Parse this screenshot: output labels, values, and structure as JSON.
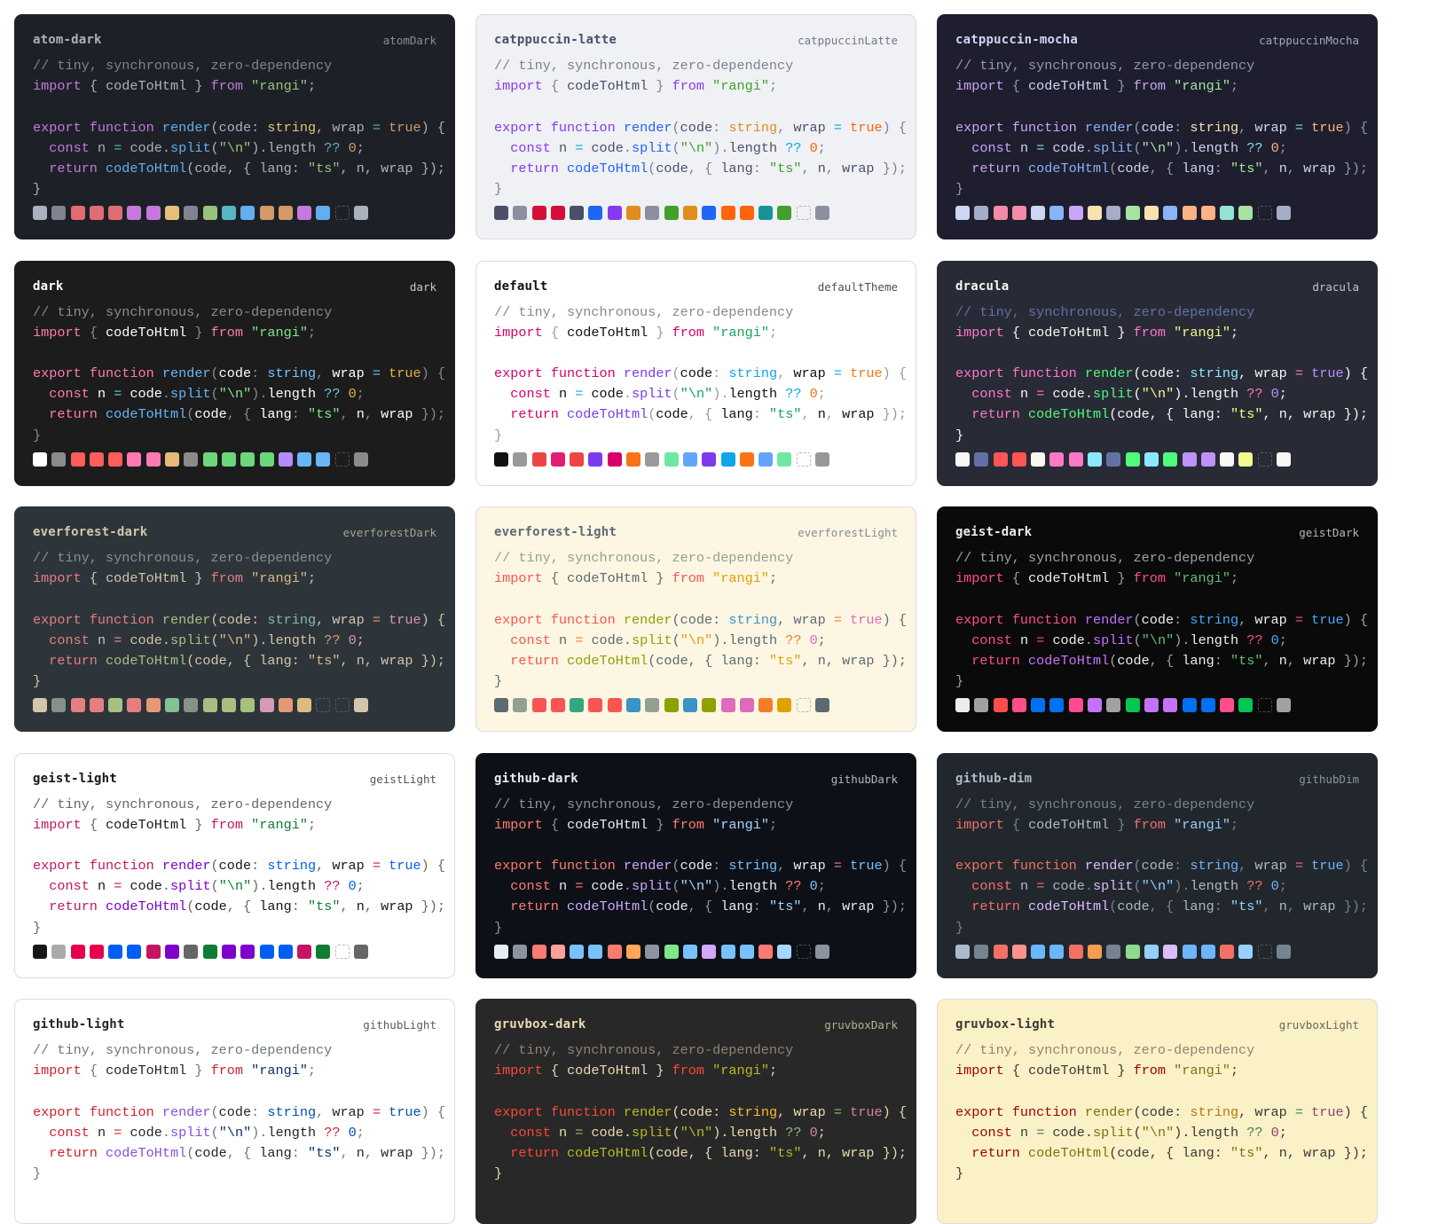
{
  "code_lines": {
    "comment": "// tiny, synchronous, zero-dependency",
    "import_kw": "import",
    "lbrace": "{",
    "rbrace": "}",
    "import_name": "codeToHtml",
    "from_kw": "from",
    "module": "\"rangi\"",
    "semi": ";",
    "export_kw": "export",
    "function_kw": "function",
    "fn_name": "render",
    "lparen": "(",
    "rparen": ")",
    "param_code": "code",
    "colon": ":",
    "type_string": "string",
    "comma": ",",
    "param_wrap": "wrap",
    "eq": "=",
    "bool_true": "true",
    "const_kw": "const",
    "var_n": "n",
    "dot": ".",
    "split_fn": "split",
    "newline_str": "\"\\n\"",
    "length_prop": "length",
    "nullish": "??",
    "zero": "0",
    "return_kw": "return",
    "call_fn": "codeToHtml",
    "prop_lang": "lang",
    "lang_ts": "\"ts\"",
    "close_call": "});",
    "close_block": "}"
  },
  "themes": [
    {
      "name": "atom-dark",
      "export": "atomDark",
      "bg": "#1d2127",
      "fg": "#abb2bf",
      "comment": "#7f848e",
      "keyword": "#c678dd",
      "fn": "#61afef",
      "string": "#98c379",
      "type": "#e5c07b",
      "number": "#d19a66",
      "punct": "#abb2bf",
      "op": "#56b6c2",
      "light": false,
      "swatches": [
        "#abb2bf",
        "#7f848e",
        "#e06c75",
        "#e06c75",
        "#e06c75",
        "#c678dd",
        "#c678dd",
        "#e5c07b",
        "#7f848e",
        "#98c379",
        "#56b6c2",
        "#61afef",
        "#d19a66",
        "#d19a66",
        "#c678dd",
        "#61afef",
        "",
        "#abb2bf"
      ]
    },
    {
      "name": "catppuccin-latte",
      "export": "catppuccinLatte",
      "bg": "#eff1f5",
      "fg": "#4c4f69",
      "comment": "#7c7f93",
      "keyword": "#8839ef",
      "fn": "#1e66f5",
      "string": "#40a02b",
      "type": "#df8e1d",
      "number": "#fe640b",
      "punct": "#7c7f93",
      "op": "#04a5e5",
      "light": true,
      "swatches": [
        "#4c4f69",
        "#8c8fa1",
        "#d20f39",
        "#d20f39",
        "#4c4f69",
        "#1e66f5",
        "#8839ef",
        "#df8e1d",
        "#8c8fa1",
        "#40a02b",
        "#df8e1d",
        "#1e66f5",
        "#fe640b",
        "#fe640b",
        "#179299",
        "#40a02b",
        "",
        "#8c8fa1"
      ]
    },
    {
      "name": "catppuccin-mocha",
      "export": "catppuccinMocha",
      "bg": "#1e1e2e",
      "fg": "#cdd6f4",
      "comment": "#9399b2",
      "keyword": "#cba6f7",
      "fn": "#89b4fa",
      "string": "#a6e3a1",
      "type": "#f9e2af",
      "number": "#fab387",
      "punct": "#9399b2",
      "op": "#89dceb",
      "light": false,
      "swatches": [
        "#cdd6f4",
        "#a6adc8",
        "#f38ba8",
        "#f38ba8",
        "#cdd6f4",
        "#89b4fa",
        "#cba6f7",
        "#f9e2af",
        "#a6adc8",
        "#a6e3a1",
        "#f9e2af",
        "#89b4fa",
        "#fab387",
        "#fab387",
        "#94e2d5",
        "#a6e3a1",
        "",
        "#a6adc8"
      ]
    },
    {
      "name": "dark",
      "export": "dark",
      "bg": "#1c1c1c",
      "fg": "#ffffff",
      "comment": "#8b8b8b",
      "keyword": "#ff7ab2",
      "fn": "#67b7f7",
      "string": "#7ee787",
      "type": "#79c0ff",
      "number": "#e3b341",
      "punct": "#8b8b8b",
      "op": "#5fd0e3",
      "light": false,
      "swatches": [
        "#ffffff",
        "#8b8b8b",
        "#ff5c5c",
        "#ff5c5c",
        "#ff5c5c",
        "#ff7ab2",
        "#ff7ab2",
        "#e6b97a",
        "#8b8b8b",
        "#6bd77a",
        "#6bd77a",
        "#6bd77a",
        "#6bd77a",
        "#b58cff",
        "#67b7f7",
        "#67b7f7",
        "",
        "#8b8b8b"
      ]
    },
    {
      "name": "default",
      "export": "defaultTheme",
      "bg": "#ffffff",
      "fg": "#111111",
      "comment": "#888888",
      "keyword": "#d7006b",
      "fn": "#7c3aed",
      "string": "#17a05d",
      "type": "#0ea5e9",
      "number": "#f97316",
      "punct": "#999999",
      "op": "#0ea5e9",
      "light": true,
      "swatches": [
        "#111111",
        "#999999",
        "#ef4444",
        "#e11d74",
        "#ef4444",
        "#7c3aed",
        "#d7006b",
        "#f97316",
        "#999999",
        "#6ee7a0",
        "#60a5fa",
        "#7c3aed",
        "#0ea5e9",
        "#f97316",
        "#60a5fa",
        "#6ee7a0",
        "",
        "#999999"
      ]
    },
    {
      "name": "dracula",
      "export": "dracula",
      "bg": "#282a36",
      "fg": "#f8f8f2",
      "comment": "#6272a4",
      "keyword": "#ff79c6",
      "fn": "#50fa7b",
      "string": "#f1fa8c",
      "type": "#8be9fd",
      "number": "#bd93f9",
      "punct": "#f8f8f2",
      "op": "#ff79c6",
      "light": false,
      "swatches": [
        "#f8f8f2",
        "#6272a4",
        "#ff5555",
        "#ff5555",
        "#f8f8f2",
        "#ff79c6",
        "#ff79c6",
        "#8be9fd",
        "#6272a4",
        "#50fa7b",
        "#8be9fd",
        "#50fa7b",
        "#bd93f9",
        "#bd93f9",
        "#f8f8f2",
        "#f1fa8c",
        "",
        "#f8f8f2"
      ]
    },
    {
      "name": "everforest-dark",
      "export": "everforestDark",
      "bg": "#2d353b",
      "fg": "#d3c6aa",
      "comment": "#859289",
      "keyword": "#e67e80",
      "fn": "#a7c080",
      "string": "#dbbc7f",
      "type": "#7fbbb3",
      "number": "#d699b6",
      "punct": "#d3c6aa",
      "op": "#e69875",
      "light": false,
      "swatches": [
        "#d3c6aa",
        "#859289",
        "#e67e80",
        "#e67e80",
        "#a7c080",
        "#e67e80",
        "#e69875",
        "#83c092",
        "#859289",
        "#a7c080",
        "#a7c080",
        "#a7c080",
        "#d699b6",
        "#e69875",
        "#dbbc7f",
        "",
        "",
        "#d3c6aa"
      ]
    },
    {
      "name": "everforest-light",
      "export": "everforestLight",
      "bg": "#fdf6e3",
      "fg": "#5c6a72",
      "comment": "#939f91",
      "keyword": "#f85552",
      "fn": "#8da101",
      "string": "#dfa000",
      "type": "#3a94c5",
      "number": "#df69ba",
      "punct": "#5c6a72",
      "op": "#f57d26",
      "light": true,
      "swatches": [
        "#5c6a72",
        "#939f91",
        "#f85552",
        "#f85552",
        "#35a77c",
        "#f85552",
        "#f85552",
        "#3a94c5",
        "#939f91",
        "#8da101",
        "#3a94c5",
        "#8da101",
        "#df69ba",
        "#df69ba",
        "#f57d26",
        "#dfa000",
        "",
        "#5c6a72"
      ]
    },
    {
      "name": "geist-dark",
      "export": "geistDark",
      "bg": "#0a0a0a",
      "fg": "#ededed",
      "comment": "#a1a1a1",
      "keyword": "#ff4d8d",
      "fn": "#c472fb",
      "string": "#62c073",
      "type": "#47a8ff",
      "number": "#47a8ff",
      "punct": "#a1a1a1",
      "op": "#ff4d8d",
      "light": false,
      "swatches": [
        "#ededed",
        "#a1a1a1",
        "#ff4d4d",
        "#ff4d8d",
        "#0070f3",
        "#0070f3",
        "#ff4d8d",
        "#c472fb",
        "#a1a1a1",
        "#00c853",
        "#c472fb",
        "#c472fb",
        "#0070f3",
        "#0070f3",
        "#ff4d8d",
        "#00c853",
        "",
        "#a1a1a1"
      ]
    },
    {
      "name": "geist-light",
      "export": "geistLight",
      "bg": "#ffffff",
      "fg": "#171717",
      "comment": "#666666",
      "keyword": "#c41562",
      "fn": "#7d00cc",
      "string": "#107d32",
      "type": "#005ff2",
      "number": "#005ff2",
      "punct": "#666666",
      "op": "#c41562",
      "light": true,
      "swatches": [
        "#171717",
        "#aaaaaa",
        "#e5004f",
        "#e5004f",
        "#005ff2",
        "#005ff2",
        "#c41562",
        "#7d00cc",
        "#666666",
        "#107d32",
        "#7d00cc",
        "#7d00cc",
        "#005ff2",
        "#005ff2",
        "#c41562",
        "#107d32",
        "",
        "#666666"
      ]
    },
    {
      "name": "github-dark",
      "export": "githubDark",
      "bg": "#0d1117",
      "fg": "#e6edf3",
      "comment": "#8b949e",
      "keyword": "#ff7b72",
      "fn": "#d2a8ff",
      "string": "#a5d6ff",
      "type": "#79c0ff",
      "number": "#79c0ff",
      "punct": "#8b949e",
      "op": "#ff7b72",
      "light": false,
      "swatches": [
        "#e6edf3",
        "#8b949e",
        "#ff7b72",
        "#ffa198",
        "#79c0ff",
        "#79c0ff",
        "#ff7b72",
        "#ffa657",
        "#8b949e",
        "#7ee787",
        "#79c0ff",
        "#d2a8ff",
        "#79c0ff",
        "#79c0ff",
        "#ff7b72",
        "#a5d6ff",
        "",
        "#8b949e"
      ]
    },
    {
      "name": "github-dim",
      "export": "githubDim",
      "bg": "#22272e",
      "fg": "#adbac7",
      "comment": "#768390",
      "keyword": "#f47067",
      "fn": "#dcbdfb",
      "string": "#96d0ff",
      "type": "#6cb6ff",
      "number": "#6cb6ff",
      "punct": "#768390",
      "op": "#f47067",
      "light": false,
      "swatches": [
        "#adbac7",
        "#768390",
        "#f47067",
        "#ff938a",
        "#6cb6ff",
        "#6cb6ff",
        "#f47067",
        "#f69d50",
        "#768390",
        "#8ddb8c",
        "#96d0ff",
        "#dcbdfb",
        "#6cb6ff",
        "#6cb6ff",
        "#f47067",
        "#96d0ff",
        "",
        "#768390"
      ]
    },
    {
      "name": "github-light",
      "export": "githubLight",
      "bg": "#ffffff",
      "fg": "#1f2328",
      "comment": "#6e7781",
      "keyword": "#cf222e",
      "fn": "#8250df",
      "string": "#0a3069",
      "type": "#0550ae",
      "number": "#0550ae",
      "punct": "#6e7781",
      "op": "#cf222e",
      "light": true,
      "swatches": []
    },
    {
      "name": "gruvbox-dark",
      "export": "gruvboxDark",
      "bg": "#282828",
      "fg": "#ebdbb2",
      "comment": "#928374",
      "keyword": "#fb4934",
      "fn": "#b8bb26",
      "string": "#b8bb26",
      "type": "#fabd2f",
      "number": "#d3869b",
      "punct": "#ebdbb2",
      "op": "#8ec07c",
      "light": false,
      "swatches": []
    },
    {
      "name": "gruvbox-light",
      "export": "gruvboxLight",
      "bg": "#fbf1c7",
      "fg": "#3c3836",
      "comment": "#928374",
      "keyword": "#9d0006",
      "fn": "#79740e",
      "string": "#79740e",
      "type": "#b57614",
      "number": "#8f3f71",
      "punct": "#3c3836",
      "op": "#427b58",
      "light": true,
      "swatches": []
    }
  ]
}
